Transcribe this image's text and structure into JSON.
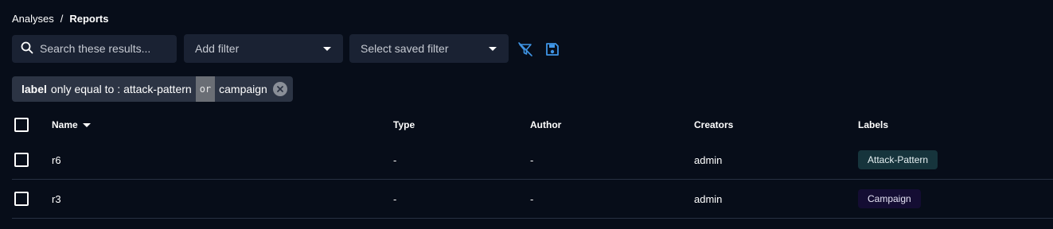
{
  "breadcrumb": {
    "parent": "Analyses",
    "separator": "/",
    "current": "Reports"
  },
  "toolbar": {
    "search_placeholder": "Search these results...",
    "add_filter_label": "Add filter",
    "saved_filter_label": "Select saved filter",
    "accent_color": "#3f95e6"
  },
  "active_filter": {
    "key": "label",
    "operator": "only equal to :",
    "value1": "attack-pattern",
    "joiner": "or",
    "value2": "campaign"
  },
  "table": {
    "columns": {
      "name": "Name",
      "type": "Type",
      "author": "Author",
      "creators": "Creators",
      "labels": "Labels"
    },
    "rows": [
      {
        "name": "r6",
        "type": "-",
        "author": "-",
        "creators": "admin",
        "label": "Attack-Pattern"
      },
      {
        "name": "r3",
        "type": "-",
        "author": "-",
        "creators": "admin",
        "label": "Campaign"
      }
    ]
  }
}
